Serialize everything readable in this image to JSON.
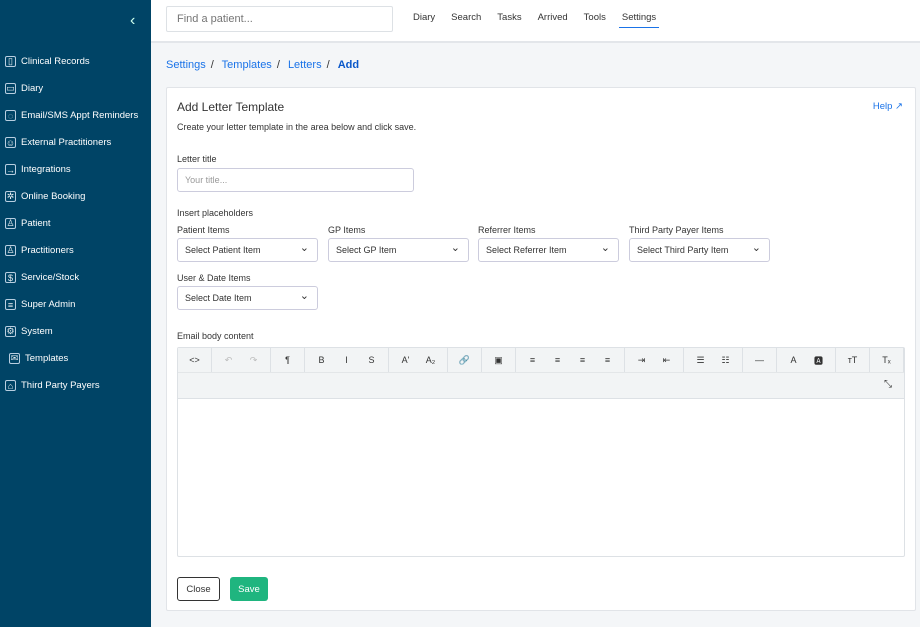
{
  "sidebar": {
    "collapse": "‹",
    "items": [
      {
        "label": "Clinical Records",
        "icon": "▯"
      },
      {
        "label": "Diary",
        "icon": "▭"
      },
      {
        "label": "Email/SMS Appt Reminders",
        "icon": "◌"
      },
      {
        "label": "External Practitioners",
        "icon": "☺"
      },
      {
        "label": "Integrations",
        "icon": "→"
      },
      {
        "label": "Online Booking",
        "icon": "✲"
      },
      {
        "label": "Patient",
        "icon": "♙"
      },
      {
        "label": "Practitioners",
        "icon": "♙"
      },
      {
        "label": "Service/Stock",
        "icon": "$"
      },
      {
        "label": "Super Admin",
        "icon": "≡"
      },
      {
        "label": "System",
        "icon": "⚙"
      },
      {
        "label": "Templates",
        "icon": "✉"
      },
      {
        "label": "Third Party Payers",
        "icon": "⌂"
      }
    ]
  },
  "topbar": {
    "search_placeholder": "Find a patient...",
    "nav": [
      "Diary",
      "Search",
      "Tasks",
      "Arrived",
      "Tools",
      "Settings"
    ]
  },
  "breadcrumb": [
    "Settings",
    "Templates",
    "Letters",
    "Add"
  ],
  "card": {
    "title": "Add Letter Template",
    "help": "Help ↗",
    "description": "Create your letter template in the area below and click save.",
    "letter_title_label": "Letter title",
    "letter_title_placeholder": "Your title...",
    "placeholders_label": "Insert placeholders",
    "selects": [
      {
        "label": "Patient Items",
        "value": "Select Patient Item"
      },
      {
        "label": "GP Items",
        "value": "Select GP Item"
      },
      {
        "label": "Referrer Items",
        "value": "Select Referrer Item"
      },
      {
        "label": "Third Party Payer Items",
        "value": "Select Third Party Item"
      },
      {
        "label": "User & Date Items",
        "value": "Select Date Item"
      }
    ],
    "body_label": "Email body content",
    "close": "Close",
    "save": "Save"
  },
  "toolbar": [
    [
      "<>"
    ],
    [
      "↶",
      "↷"
    ],
    [
      "¶"
    ],
    [
      "B",
      "I",
      "S"
    ],
    [
      "A'",
      "A₂"
    ],
    [
      "🔗"
    ],
    [
      "▣"
    ],
    [
      "≡",
      "≡",
      "≡",
      "≡"
    ],
    [
      "⇥",
      "⇤"
    ],
    [
      "☰",
      "☷"
    ],
    [
      "—"
    ],
    [
      "A",
      "🅰"
    ],
    [
      "ᴛT"
    ],
    [
      "Tₓ"
    ]
  ],
  "fullscreen": "⤡",
  "colors": {
    "sidebar": "#004466",
    "accent": "#1a73e8",
    "save": "#1fb57f"
  }
}
